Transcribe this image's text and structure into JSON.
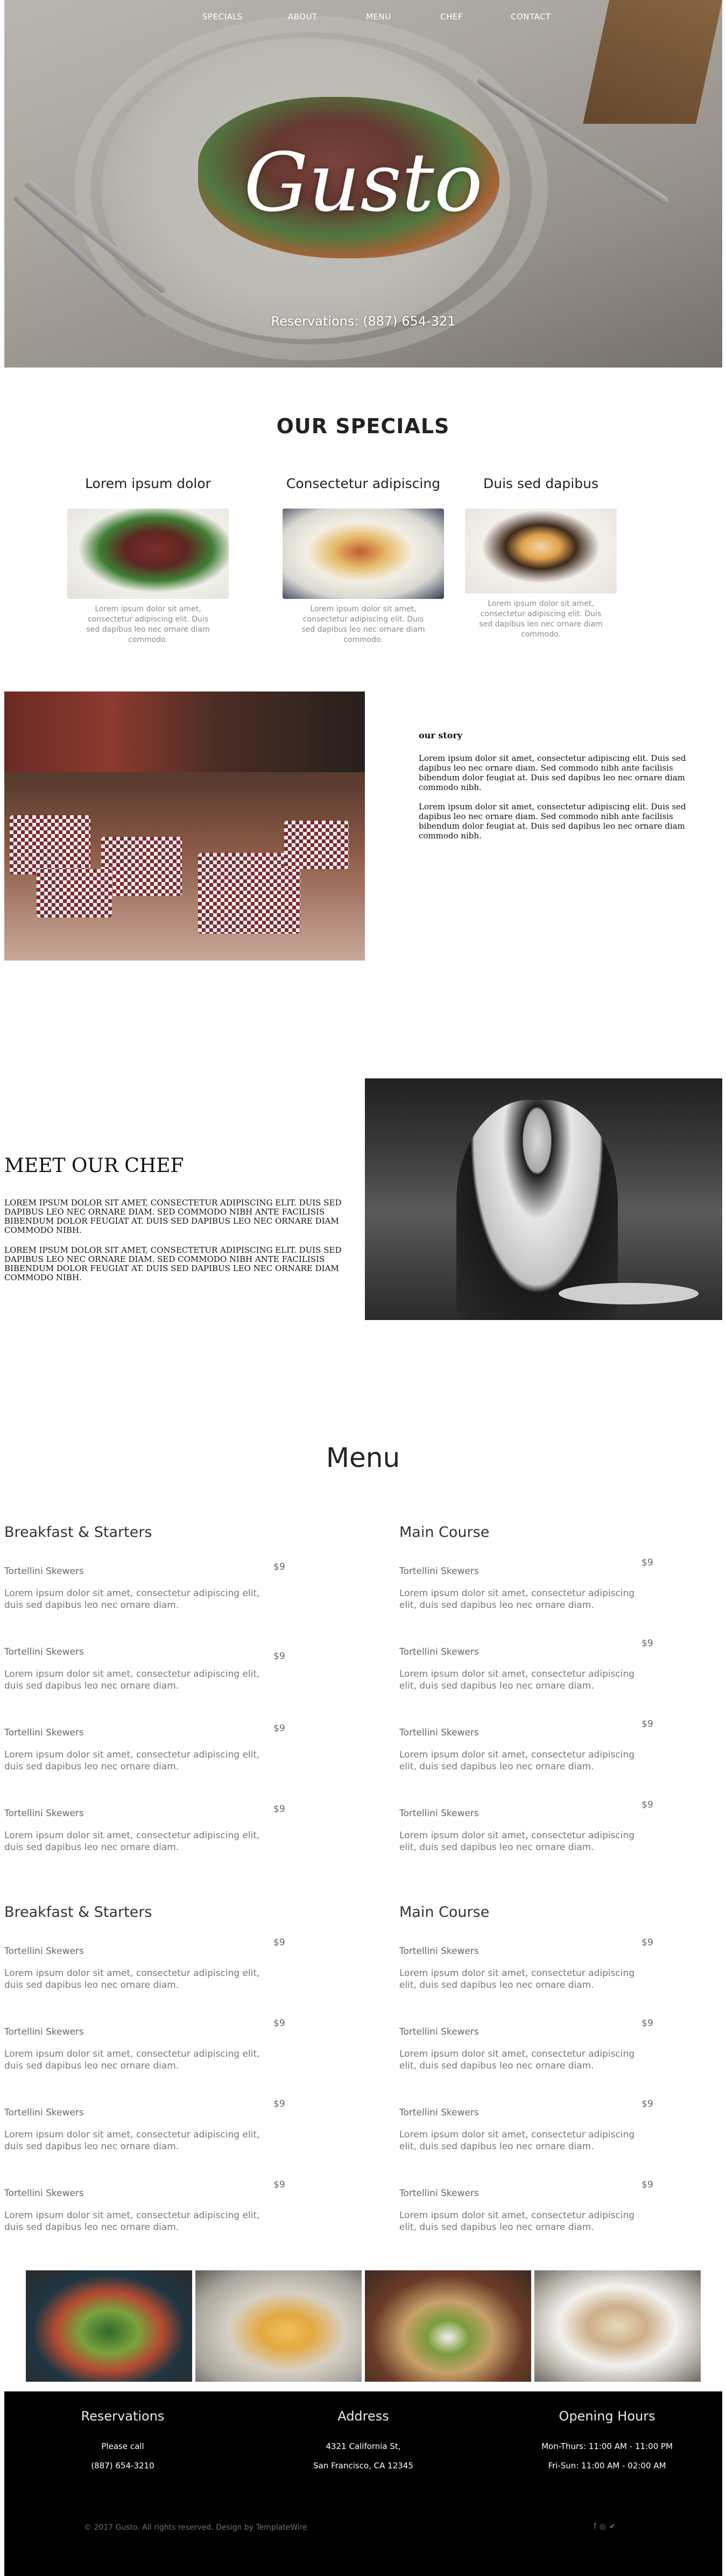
{
  "nav": {
    "items": [
      "SPECIALS",
      "ABOUT",
      "MENU",
      "CHEF",
      "CONTACT"
    ]
  },
  "hero": {
    "brand": "Gusto",
    "reservations": "Reservations: (887) 654-321"
  },
  "specials": {
    "title": "OUR SPECIALS",
    "items": [
      {
        "title": "Lorem ipsum dolor",
        "text": "Lorem ipsum dolor sit amet, consectetur adipiscing elit. Duis sed dapibus leo nec ornare diam commodo."
      },
      {
        "title": "Consectetur adipiscing",
        "text": "Lorem ipsum dolor sit amet, consectetur adipiscing elit. Duis sed dapibus leo nec ornare diam commodo."
      },
      {
        "title": "Duis sed dapibus",
        "text": "Lorem ipsum dolor sit amet, consectetur adipiscing elit. Duis sed dapibus leo nec ornare diam commodo."
      }
    ]
  },
  "story": {
    "heading": "our story",
    "paragraphs": [
      "Lorem ipsum dolor sit amet, consectetur adipiscing elit. Duis sed dapibus leo nec ornare diam. Sed commodo nibh ante facilisis bibendum dolor feugiat at. Duis sed dapibus leo nec ornare diam commodo nibh.",
      "Lorem ipsum dolor sit amet, consectetur adipiscing elit. Duis sed dapibus leo nec ornare diam. Sed commodo nibh ante facilisis bibendum dolor feugiat at. Duis sed dapibus leo nec ornare diam commodo nibh."
    ]
  },
  "chef": {
    "heading": "MEET OUR CHEF",
    "paragraphs": [
      "Lorem ipsum dolor sit amet, consectetur adipiscing elit. Duis sed dapibus leo nec ornare diam. Sed commodo nibh ante facilisis bibendum dolor feugiat at. Duis sed dapibus leo nec ornare diam commodo nibh.",
      "Lorem ipsum dolor sit amet, consectetur adipiscing elit. Duis sed dapibus leo nec ornare diam. Sed commodo nibh ante facilisis bibendum dolor feugiat at. Duis sed dapibus leo nec ornare diam commodo nibh."
    ]
  },
  "menu": {
    "title": "Menu",
    "sections": [
      {
        "heading": "Breakfast & Starters",
        "items": [
          {
            "name": "Tortellini Skewers",
            "price": "$9",
            "desc": "Lorem ipsum dolor sit amet, consectetur adipiscing elit, duis sed dapibus leo nec ornare diam."
          },
          {
            "name": "Tortellini Skewers",
            "price": "$9",
            "desc": "Lorem ipsum dolor sit amet, consectetur adipiscing elit, duis sed dapibus leo nec ornare diam."
          },
          {
            "name": "Tortellini Skewers",
            "price": "$9",
            "desc": "Lorem ipsum dolor sit amet, consectetur adipiscing elit, duis sed dapibus leo nec ornare diam."
          },
          {
            "name": "Tortellini Skewers",
            "price": "$9",
            "desc": "Lorem ipsum dolor sit amet, consectetur adipiscing elit, duis sed dapibus leo nec ornare diam."
          }
        ]
      },
      {
        "heading": "Main Course",
        "items": [
          {
            "name": "Tortellini Skewers",
            "price": "$9",
            "desc": "Lorem ipsum dolor sit amet, consectetur adipiscing elit, duis sed dapibus leo nec ornare diam."
          },
          {
            "name": "Tortellini Skewers",
            "price": "$9",
            "desc": "Lorem ipsum dolor sit amet, consectetur adipiscing elit, duis sed dapibus leo nec ornare diam."
          },
          {
            "name": "Tortellini Skewers",
            "price": "$9",
            "desc": "Lorem ipsum dolor sit amet, consectetur adipiscing elit, duis sed dapibus leo nec ornare diam."
          },
          {
            "name": "Tortellini Skewers",
            "price": "$9",
            "desc": "Lorem ipsum dolor sit amet, consectetur adipiscing elit, duis sed dapibus leo nec ornare diam."
          }
        ]
      },
      {
        "heading": "Breakfast & Starters",
        "items": [
          {
            "name": "Tortellini Skewers",
            "price": "$9",
            "desc": "Lorem ipsum dolor sit amet, consectetur adipiscing elit, duis sed dapibus leo nec ornare diam."
          },
          {
            "name": "Tortellini Skewers",
            "price": "$9",
            "desc": "Lorem ipsum dolor sit amet, consectetur adipiscing elit, duis sed dapibus leo nec ornare diam."
          },
          {
            "name": "Tortellini Skewers",
            "price": "$9",
            "desc": "Lorem ipsum dolor sit amet, consectetur adipiscing elit, duis sed dapibus leo nec ornare diam."
          },
          {
            "name": "Tortellini Skewers",
            "price": "$9",
            "desc": "Lorem ipsum dolor sit amet, consectetur adipiscing elit, duis sed dapibus leo nec ornare diam."
          }
        ]
      },
      {
        "heading": "Main Course",
        "items": [
          {
            "name": "Tortellini Skewers",
            "price": "$9",
            "desc": "Lorem ipsum dolor sit amet, consectetur adipiscing elit, duis sed dapibus leo nec ornare diam."
          },
          {
            "name": "Tortellini Skewers",
            "price": "$9",
            "desc": "Lorem ipsum dolor sit amet, consectetur adipiscing elit, duis sed dapibus leo nec ornare diam."
          },
          {
            "name": "Tortellini Skewers",
            "price": "$9",
            "desc": "Lorem ipsum dolor sit amet, consectetur adipiscing elit, duis sed dapibus leo nec ornare diam."
          },
          {
            "name": "Tortellini Skewers",
            "price": "$9",
            "desc": "Lorem ipsum dolor sit amet, consectetur adipiscing elit, duis sed dapibus leo nec ornare diam."
          }
        ]
      }
    ]
  },
  "footer": {
    "reservations": {
      "heading": "Reservations",
      "line1": "Please call",
      "line2": "(887) 654-3210"
    },
    "address": {
      "heading": "Address",
      "line1": "4321 California St,",
      "line2": "San Francisco, CA 12345"
    },
    "hours": {
      "heading": "Opening Hours",
      "line1": "Mon-Thurs: 11:00 AM - 11:00 PM",
      "line2": "Fri-Sun: 11:00 AM - 02:00 AM"
    },
    "copyright": "© 2017 Gusto. All rights reserved. Design by TemplateWire",
    "social_icons": [
      "facebook-icon",
      "instagram-icon",
      "twitter-icon"
    ]
  }
}
